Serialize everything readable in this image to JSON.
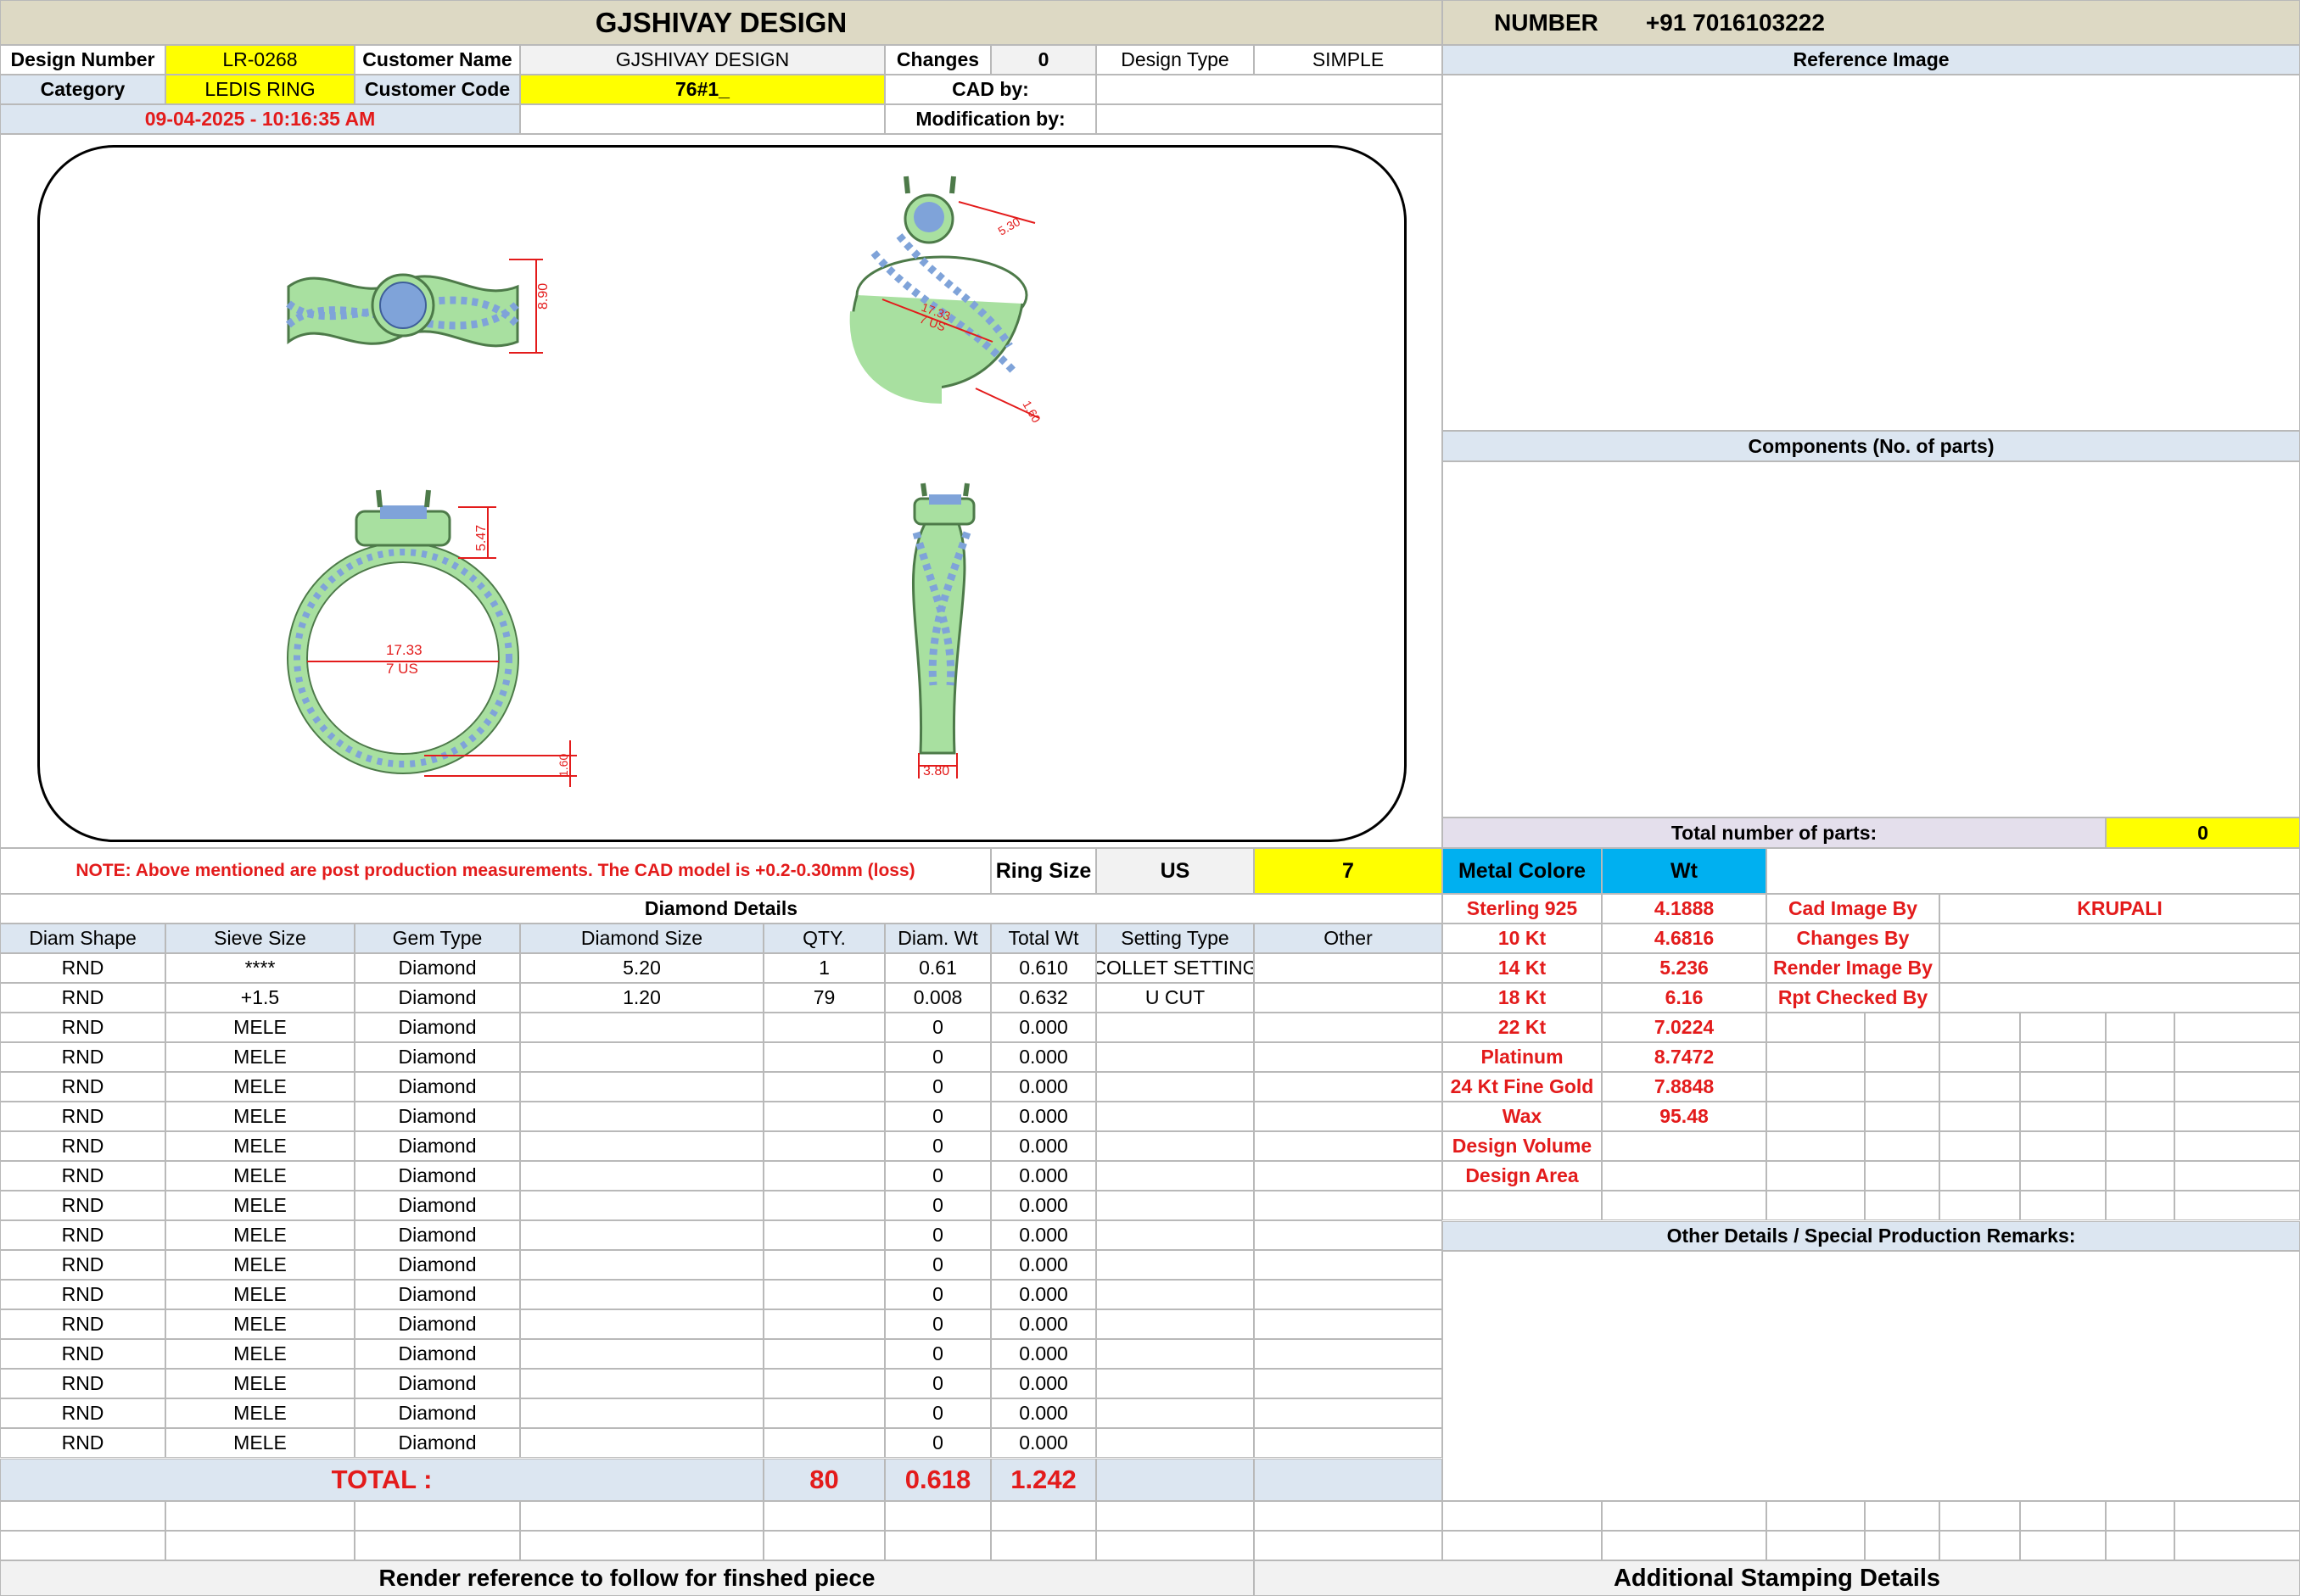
{
  "header": {
    "company": "GJSHIVAY DESIGN",
    "number_label": "NUMBER",
    "number_value": "+91 7016103222"
  },
  "info": {
    "design_number_label": "Design Number",
    "design_number": "LR-0268",
    "customer_name_label": "Customer Name",
    "customer_name": "GJSHIVAY DESIGN",
    "changes_label": "Changes",
    "changes": "0",
    "design_type_label": "Design Type",
    "design_type": "SIMPLE",
    "category_label": "Category",
    "category": "LEDIS RING",
    "customer_code_label": "Customer Code",
    "customer_code": "76#1_",
    "cad_by_label": "CAD by:",
    "cad_by": "",
    "timestamp": "09-04-2025 - 10:16:35 AM",
    "modification_by_label": "Modification by:",
    "modification_by": ""
  },
  "right_panel": {
    "reference_image": "Reference Image",
    "components": "Components (No. of parts)",
    "total_parts_label": "Total number of parts:",
    "total_parts": "0"
  },
  "views": {
    "top_height": "8.90",
    "persp_a": "5.30",
    "persp_b": "17.33",
    "persp_c": "7 US",
    "persp_d": "1.60",
    "front_height": "5.47",
    "front_dia": "17.33",
    "front_size": "7 US",
    "front_thick": "1.60",
    "side_width": "3.80"
  },
  "note_row": {
    "note": "NOTE: Above mentioned are post production measurements. The CAD model is +0.2-0.30mm (loss)",
    "ring_size_label": "Ring Size",
    "ring_size_unit": "US",
    "ring_size": "7",
    "metal_color_label": "Metal Colore",
    "wt_label": "Wt"
  },
  "diamond_section": {
    "title": "Diamond Details",
    "headers": [
      "Diam Shape",
      "Sieve Size",
      "Gem Type",
      "Diamond Size",
      "QTY.",
      "Diam. Wt",
      "Total Wt",
      "Setting Type",
      "Other"
    ],
    "rows": [
      [
        "RND",
        "****",
        "Diamond",
        "5.20",
        "1",
        "0.61",
        "0.610",
        "COLLET SETTING",
        ""
      ],
      [
        "RND",
        "+1.5",
        "Diamond",
        "1.20",
        "79",
        "0.008",
        "0.632",
        "U CUT",
        ""
      ],
      [
        "RND",
        "MELE",
        "Diamond",
        "",
        "",
        "0",
        "0.000",
        "",
        ""
      ],
      [
        "RND",
        "MELE",
        "Diamond",
        "",
        "",
        "0",
        "0.000",
        "",
        ""
      ],
      [
        "RND",
        "MELE",
        "Diamond",
        "",
        "",
        "0",
        "0.000",
        "",
        ""
      ],
      [
        "RND",
        "MELE",
        "Diamond",
        "",
        "",
        "0",
        "0.000",
        "",
        ""
      ],
      [
        "RND",
        "MELE",
        "Diamond",
        "",
        "",
        "0",
        "0.000",
        "",
        ""
      ],
      [
        "RND",
        "MELE",
        "Diamond",
        "",
        "",
        "0",
        "0.000",
        "",
        ""
      ],
      [
        "RND",
        "MELE",
        "Diamond",
        "",
        "",
        "0",
        "0.000",
        "",
        ""
      ],
      [
        "RND",
        "MELE",
        "Diamond",
        "",
        "",
        "0",
        "0.000",
        "",
        ""
      ],
      [
        "RND",
        "MELE",
        "Diamond",
        "",
        "",
        "0",
        "0.000",
        "",
        ""
      ],
      [
        "RND",
        "MELE",
        "Diamond",
        "",
        "",
        "0",
        "0.000",
        "",
        ""
      ],
      [
        "RND",
        "MELE",
        "Diamond",
        "",
        "",
        "0",
        "0.000",
        "",
        ""
      ],
      [
        "RND",
        "MELE",
        "Diamond",
        "",
        "",
        "0",
        "0.000",
        "",
        ""
      ],
      [
        "RND",
        "MELE",
        "Diamond",
        "",
        "",
        "0",
        "0.000",
        "",
        ""
      ],
      [
        "RND",
        "MELE",
        "Diamond",
        "",
        "",
        "0",
        "0.000",
        "",
        ""
      ],
      [
        "RND",
        "MELE",
        "Diamond",
        "",
        "",
        "0",
        "0.000",
        "",
        ""
      ]
    ],
    "total_label": "TOTAL :",
    "total_qty": "80",
    "total_diam_wt": "0.618",
    "total_wt": "1.242"
  },
  "metals": [
    {
      "name": "Sterling 925",
      "wt": "4.1888"
    },
    {
      "name": "10 Kt",
      "wt": "4.6816"
    },
    {
      "name": "14 Kt",
      "wt": "5.236"
    },
    {
      "name": "18 Kt",
      "wt": "6.16"
    },
    {
      "name": "22 Kt",
      "wt": "7.0224"
    },
    {
      "name": "Platinum",
      "wt": "8.7472"
    },
    {
      "name": "24 Kt Fine Gold",
      "wt": "7.8848"
    },
    {
      "name": "Wax",
      "wt": "95.48"
    },
    {
      "name": "Design Volume",
      "wt": ""
    },
    {
      "name": "Design Area",
      "wt": ""
    }
  ],
  "credits": [
    {
      "label": "Cad Image By",
      "value": "KRUPALI"
    },
    {
      "label": "Changes By",
      "value": ""
    },
    {
      "label": "Render Image By",
      "value": ""
    },
    {
      "label": "Rpt Checked By",
      "value": ""
    }
  ],
  "other_details": "Other Details / Special Production Remarks:",
  "footer": {
    "render_reference": "Render reference to follow for finshed piece",
    "stamping": "Additional Stamping Details"
  },
  "colors": {
    "header_beige": "#ddd9c4",
    "highlight_yellow": "#ffff00",
    "section_blue": "#dce6f1",
    "metal_cyan": "#00b0f0",
    "text_red": "#e31b1b",
    "ring_green": "#a8e0a0",
    "stone_blue": "#7fa3d9"
  }
}
